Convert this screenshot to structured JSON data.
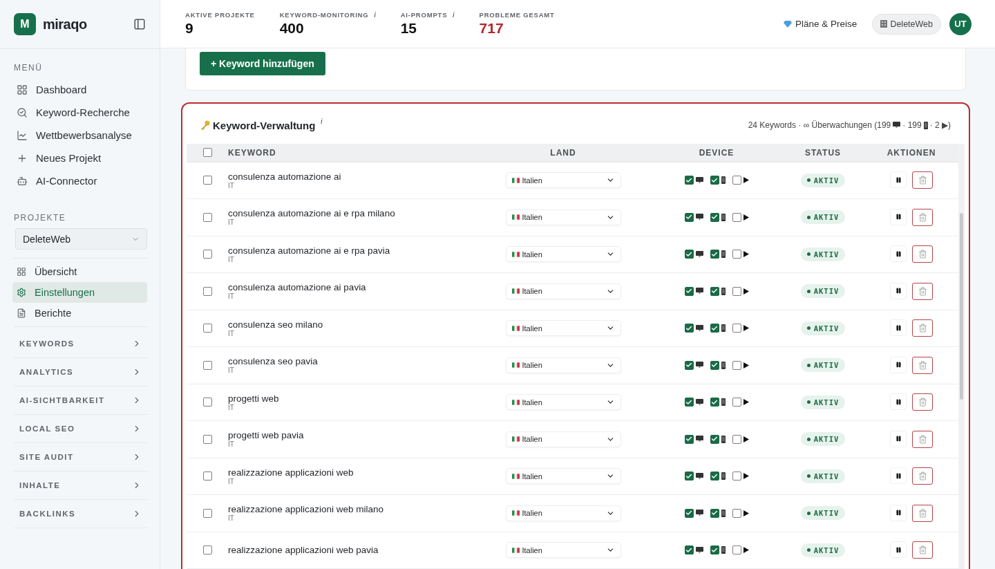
{
  "brand": {
    "name": "miraqo",
    "logo_letter": "M"
  },
  "sidebar": {
    "menu_heading": "MENÜ",
    "menu": [
      {
        "label": "Dashboard",
        "selected": false
      },
      {
        "label": "Keyword-Recherche",
        "selected": false
      },
      {
        "label": "Wettbewerbsanalyse",
        "selected": false
      },
      {
        "label": "Neues Projekt",
        "selected": false
      },
      {
        "label": "AI-Connector",
        "selected": false
      }
    ],
    "projects_heading": "PROJEKTE",
    "project_select": {
      "value": "DeleteWeb"
    },
    "project_menu": [
      {
        "label": "Übersicht",
        "selected": false
      },
      {
        "label": "Einstellungen",
        "selected": true
      },
      {
        "label": "Berichte",
        "selected": false
      }
    ],
    "sections": [
      {
        "label": "KEYWORDS",
        "expanded": false
      },
      {
        "label": "ANALYTICS",
        "expanded": false
      },
      {
        "label": "AI-SICHTBARKEIT",
        "expanded": false
      },
      {
        "label": "LOCAL SEO",
        "expanded": false
      },
      {
        "label": "SITE AUDIT",
        "expanded": false
      },
      {
        "label": "INHALTE",
        "expanded": false
      },
      {
        "label": "BACKLINKS",
        "expanded": false
      }
    ]
  },
  "stats": [
    {
      "label": "AKTIVE PROJEKTE",
      "value": "9",
      "alert": false
    },
    {
      "label": "KEYWORD-MONITORING",
      "value": "400",
      "info": "i",
      "alert": false
    },
    {
      "label": "AI-PROMPTS",
      "value": "15",
      "info": "i",
      "alert": false
    },
    {
      "label": "PROBLEME GESAMT",
      "value": "717",
      "alert": true
    }
  ],
  "header": {
    "plans": "Pläne & Preise",
    "workspace": "DeleteWeb",
    "avatar": "UT"
  },
  "add_button": "+ Keyword hinzufügen",
  "keyword_panel": {
    "title": "Keyword-Verwaltung",
    "info": "i",
    "summary": [
      {
        "kind": "text",
        "text": "24 Keywords · ∞ Überwachungen (199"
      },
      {
        "kind": "desktop"
      },
      {
        "kind": "text",
        "text": "· 199"
      },
      {
        "kind": "mobile"
      },
      {
        "kind": "text",
        "text": "· 2 ▶)"
      }
    ],
    "columns": [
      "KEYWORD",
      "LAND",
      "DEVICE",
      "STATUS",
      "AKTIONEN"
    ],
    "select_all": false,
    "rows": [
      {
        "keyword": "consulenza automazione ai",
        "code": "IT",
        "country": "Italien",
        "checked": false,
        "devices": [
          {
            "kind": "desktop",
            "checked": true
          },
          {
            "kind": "mobile",
            "checked": true
          },
          {
            "kind": "video",
            "checked": false
          }
        ],
        "status": "AKTIV"
      },
      {
        "keyword": "consulenza automazione ai e rpa milano",
        "code": "IT",
        "country": "Italien",
        "checked": false,
        "devices": [
          {
            "kind": "desktop",
            "checked": true
          },
          {
            "kind": "mobile",
            "checked": true
          },
          {
            "kind": "video",
            "checked": false
          }
        ],
        "status": "AKTIV"
      },
      {
        "keyword": "consulenza automazione ai e rpa pavia",
        "code": "IT",
        "country": "Italien",
        "checked": false,
        "devices": [
          {
            "kind": "desktop",
            "checked": true
          },
          {
            "kind": "mobile",
            "checked": true
          },
          {
            "kind": "video",
            "checked": false
          }
        ],
        "status": "AKTIV"
      },
      {
        "keyword": "consulenza automazione ai pavia",
        "code": "IT",
        "country": "Italien",
        "checked": false,
        "devices": [
          {
            "kind": "desktop",
            "checked": true
          },
          {
            "kind": "mobile",
            "checked": true
          },
          {
            "kind": "video",
            "checked": false
          }
        ],
        "status": "AKTIV"
      },
      {
        "keyword": "consulenza seo milano",
        "code": "IT",
        "country": "Italien",
        "checked": false,
        "devices": [
          {
            "kind": "desktop",
            "checked": true
          },
          {
            "kind": "mobile",
            "checked": true
          },
          {
            "kind": "video",
            "checked": false
          }
        ],
        "status": "AKTIV"
      },
      {
        "keyword": "consulenza seo pavia",
        "code": "IT",
        "country": "Italien",
        "checked": false,
        "devices": [
          {
            "kind": "desktop",
            "checked": true
          },
          {
            "kind": "mobile",
            "checked": true
          },
          {
            "kind": "video",
            "checked": false
          }
        ],
        "status": "AKTIV"
      },
      {
        "keyword": "progetti web",
        "code": "IT",
        "country": "Italien",
        "checked": false,
        "devices": [
          {
            "kind": "desktop",
            "checked": true
          },
          {
            "kind": "mobile",
            "checked": true
          },
          {
            "kind": "video",
            "checked": false
          }
        ],
        "status": "AKTIV"
      },
      {
        "keyword": "progetti web pavia",
        "code": "IT",
        "country": "Italien",
        "checked": false,
        "devices": [
          {
            "kind": "desktop",
            "checked": true
          },
          {
            "kind": "mobile",
            "checked": true
          },
          {
            "kind": "video",
            "checked": false
          }
        ],
        "status": "AKTIV"
      },
      {
        "keyword": "realizzazione applicazioni web",
        "code": "IT",
        "country": "Italien",
        "checked": false,
        "devices": [
          {
            "kind": "desktop",
            "checked": true
          },
          {
            "kind": "mobile",
            "checked": true
          },
          {
            "kind": "video",
            "checked": false
          }
        ],
        "status": "AKTIV"
      },
      {
        "keyword": "realizzazione applicazioni web milano",
        "code": "IT",
        "country": "Italien",
        "checked": false,
        "devices": [
          {
            "kind": "desktop",
            "checked": true
          },
          {
            "kind": "mobile",
            "checked": true
          },
          {
            "kind": "video",
            "checked": false
          }
        ],
        "status": "AKTIV"
      },
      {
        "keyword": "realizzazione applicazioni web pavia",
        "country": "Italien",
        "checked": false,
        "devices": [
          {
            "kind": "desktop",
            "checked": true
          },
          {
            "kind": "mobile",
            "checked": true
          },
          {
            "kind": "video",
            "checked": false
          }
        ],
        "status": "AKTIV"
      }
    ]
  }
}
